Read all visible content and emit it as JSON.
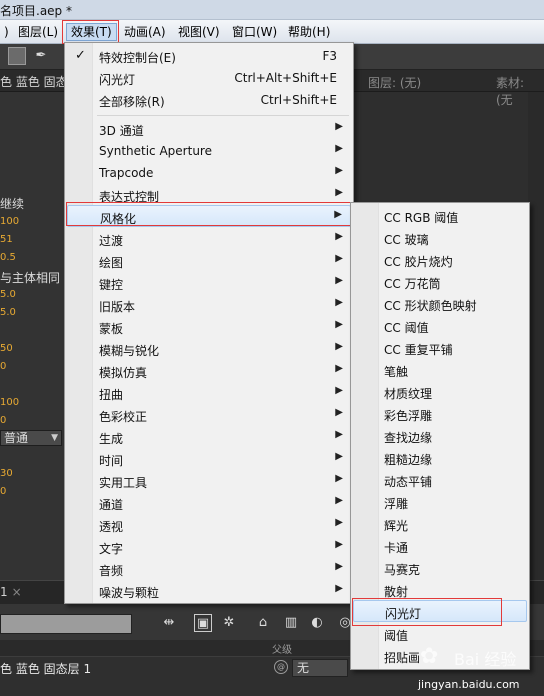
{
  "window": {
    "title": "名项目.aep *"
  },
  "menubar": {
    "items": [
      {
        "label": ")"
      },
      {
        "label": "图层(L)"
      },
      {
        "label": "效果(T)"
      },
      {
        "label": "动画(A)"
      },
      {
        "label": "视图(V)"
      },
      {
        "label": "窗口(W)"
      },
      {
        "label": "帮助(H)"
      }
    ]
  },
  "panel_header": {
    "left_tab": "色 蓝色 固态",
    "layer_label": "图层: (无)",
    "footage_label": "素材: (无"
  },
  "left_panel": {
    "items": [
      "继续",
      "100",
      "51",
      "0.5",
      "与主体相同",
      "5.0",
      "5.0",
      "50",
      "0",
      "100",
      "0",
      "30",
      "0"
    ],
    "dropdown": "普通"
  },
  "effects_menu": {
    "top_items": [
      {
        "label": "特效控制台(E)",
        "shortcut": "F3",
        "checked": true
      },
      {
        "label": "闪光灯",
        "shortcut": "Ctrl+Alt+Shift+E"
      },
      {
        "label": "全部移除(R)",
        "shortcut": "Ctrl+Shift+E"
      }
    ],
    "categories": [
      "3D 通道",
      "Synthetic Aperture",
      "Trapcode",
      "表达式控制",
      "风格化",
      "过渡",
      "绘图",
      "键控",
      "旧版本",
      "蒙板",
      "模糊与锐化",
      "模拟仿真",
      "扭曲",
      "色彩校正",
      "生成",
      "时间",
      "实用工具",
      "通道",
      "透视",
      "文字",
      "音频",
      "噪波与颗粒"
    ],
    "highlighted": "风格化"
  },
  "stylize_menu": {
    "items": [
      "CC RGB 阈值",
      "CC 玻璃",
      "CC 胶片烧灼",
      "CC 万花筒",
      "CC 形状颜色映射",
      "CC 阈值",
      "CC 重复平铺",
      "笔触",
      "材质纹理",
      "彩色浮雕",
      "查找边缘",
      "粗糙边缘",
      "动态平铺",
      "浮雕",
      "辉光",
      "卡通",
      "马赛克",
      "散射",
      "闪光灯",
      "阈值",
      "招贴画"
    ],
    "highlighted": "闪光灯"
  },
  "timeline": {
    "tab": "1",
    "parent_column": "父级",
    "layer_name": "色 蓝色 固态层 1",
    "parent_value": "无"
  },
  "watermark": {
    "brand": "Bai 经验",
    "url": "jingyan.baidu.com"
  },
  "colors": {
    "highlight_border": "#e23a3a",
    "menu_bg": "#f1f1f1",
    "panel_bg": "#333333",
    "value_orange": "#e7a933"
  }
}
